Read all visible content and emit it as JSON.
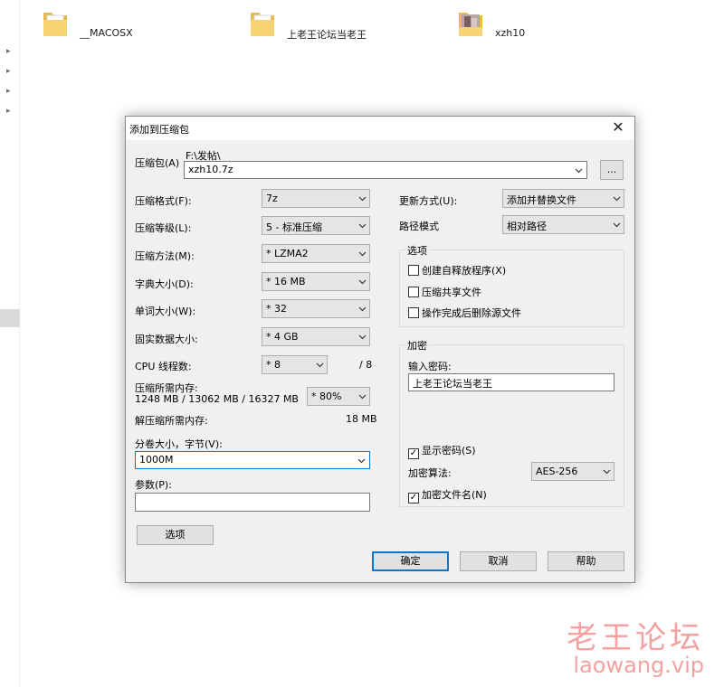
{
  "explorer": {
    "files": [
      {
        "name": "__MACOSX",
        "icon": "folder-icon"
      },
      {
        "name": "上老王论坛当老王",
        "icon": "folder-icon"
      },
      {
        "name": "xzh10",
        "icon": "image-folder-icon"
      }
    ]
  },
  "dialog": {
    "title": "添加到压缩包",
    "close_glyph": "✕",
    "archive": {
      "label": "压缩包(A)",
      "path": "F:\\发帖\\",
      "value": "xzh10.7z",
      "browse": "..."
    },
    "left": {
      "format": {
        "label": "压缩格式(F):",
        "value": "7z"
      },
      "level": {
        "label": "压缩等级(L):",
        "value": "5 - 标准压缩"
      },
      "method": {
        "label": "压缩方法(M):",
        "value": "* LZMA2"
      },
      "dict": {
        "label": "字典大小(D):",
        "value": "* 16 MB"
      },
      "word": {
        "label": "单词大小(W):",
        "value": "* 32"
      },
      "solid": {
        "label": "固实数据大小:",
        "value": "* 4 GB"
      },
      "cpu": {
        "label": "CPU 线程数:",
        "value": "* 8",
        "total": "/ 8"
      },
      "mem": {
        "label": "压缩所需内存:",
        "detail": "1248 MB / 13062 MB / 16327 MB",
        "value": "* 80%"
      },
      "decomp": {
        "label": "解压缩所需内存:",
        "value": "18 MB"
      },
      "volume": {
        "label": "分卷大小，字节(V):",
        "value": "1000M"
      },
      "params": {
        "label": "参数(P):",
        "value": ""
      },
      "options_button": "选项"
    },
    "right": {
      "update": {
        "label": "更新方式(U):",
        "value": "添加并替换文件"
      },
      "path": {
        "label": "路径模式",
        "value": "相对路径"
      },
      "options": {
        "title": "选项",
        "sfx": {
          "label": "创建自释放程序(X)",
          "checked": false
        },
        "shared": {
          "label": "压缩共享文件",
          "checked": false
        },
        "delete": {
          "label": "操作完成后删除源文件",
          "checked": false
        }
      },
      "encryption": {
        "title": "加密",
        "pw_label": "输入密码:",
        "pw_value": "上老王论坛当老王",
        "show": {
          "label": "显示密码(S)",
          "checked": true
        },
        "algo_label": "加密算法:",
        "algo_value": "AES-256",
        "names": {
          "label": "加密文件名(N)",
          "checked": true
        }
      }
    },
    "buttons": {
      "ok": "确定",
      "cancel": "取消",
      "help": "帮助"
    }
  },
  "watermark": {
    "cn": "老王论坛",
    "url": "laowang.vip",
    "color": "#f3a1a1"
  }
}
